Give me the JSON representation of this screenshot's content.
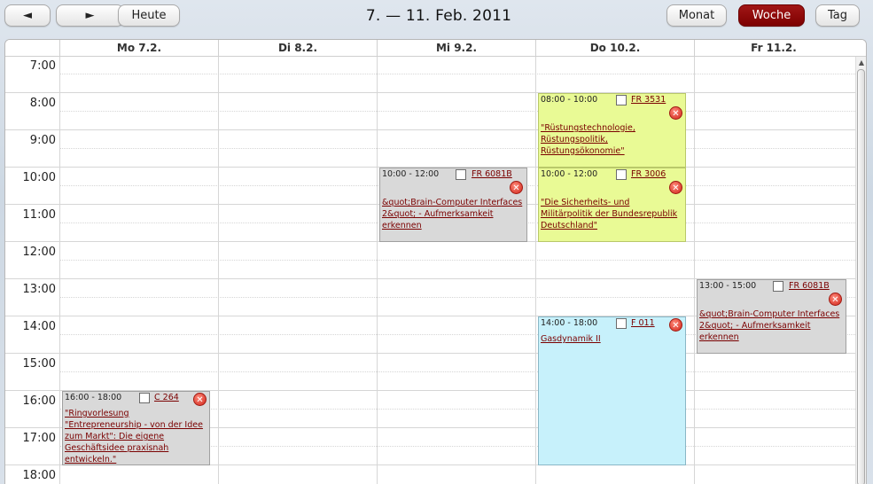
{
  "toolbar": {
    "prev_label": "◄",
    "next_label": "►",
    "today_label": "Heute",
    "month_label": "Monat",
    "week_label": "Woche",
    "day_label": "Tag"
  },
  "range_title": "7. — 11. Feb. 2011",
  "days": [
    "Mo 7.2.",
    "Di 8.2.",
    "Mi 9.2.",
    "Do 10.2.",
    "Fr 11.2."
  ],
  "hours": [
    "7:00",
    "8:00",
    "9:00",
    "10:00",
    "11:00",
    "12:00",
    "13:00",
    "14:00",
    "15:00",
    "16:00",
    "17:00",
    "18:00"
  ],
  "events": {
    "mo": {
      "time": "16:00 - 18:00",
      "room": "C 264",
      "title": "\"Ringvorlesung \"Entrepreneurship - von der Idee zum Markt\": Die eigene Geschäftsidee praxisnah entwickeln.\""
    },
    "mi": {
      "time": "10:00 - 12:00",
      "room": "FR 6081B",
      "title": "&quot;Brain-Computer Interfaces 2&quot; - Aufmerksamkeit erkennen"
    },
    "do1": {
      "time": "08:00 - 10:00",
      "room": "FR 3531",
      "title": "\"Rüstungstechnologie, Rüstungspolitik, Rüstungsökonomie\""
    },
    "do2": {
      "time": "10:00 - 12:00",
      "room": "FR 3006",
      "title": "\"Die Sicherheits- und Militärpolitik der Bundesrepublik Deutschland\""
    },
    "do3": {
      "time": "14:00 - 18:00",
      "room": "F 011",
      "title": "Gasdynamik II"
    },
    "fr": {
      "time": "13:00 - 15:00",
      "room": "FR 6081B",
      "title": "&quot;Brain-Computer Interfaces 2&quot; - Aufmerksamkeit erkennen"
    }
  },
  "delete_glyph": "✕",
  "colors": {
    "active_tab": "#8b0000",
    "event_gray": "#d9d9d9",
    "event_green": "#e9fa95",
    "event_cyan": "#c7f1fb",
    "link": "#7a0000"
  }
}
